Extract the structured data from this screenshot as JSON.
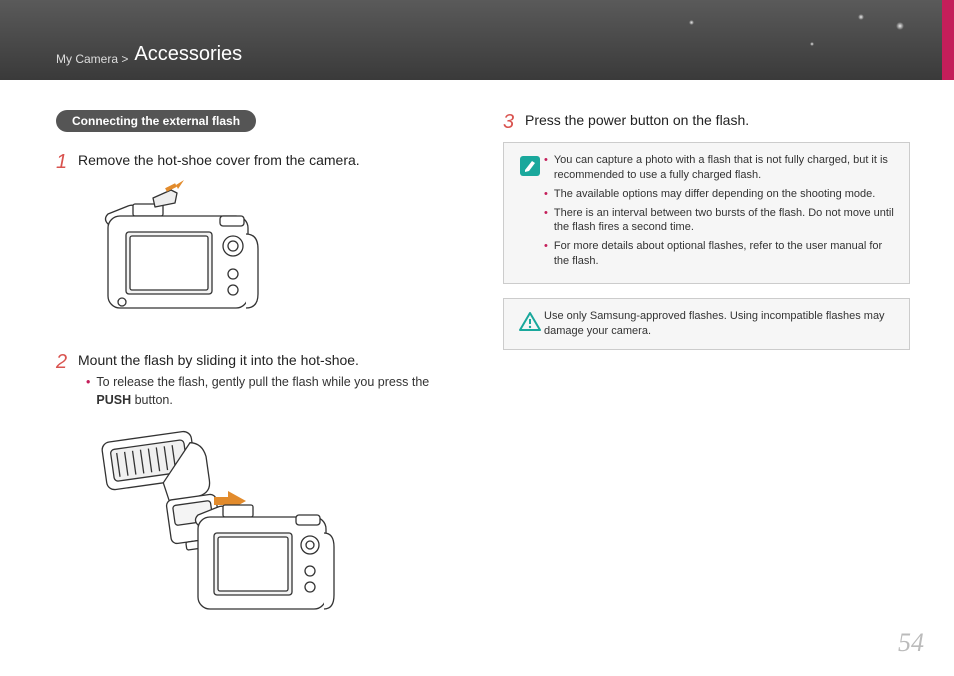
{
  "header": {
    "breadcrumb_parent": "My Camera >",
    "breadcrumb_title": "Accessories"
  },
  "left": {
    "section_label": "Connecting the external flash",
    "step1": {
      "num": "1",
      "text": "Remove the hot-shoe cover from the camera."
    },
    "step2": {
      "num": "2",
      "text": "Mount the flash by sliding it into the hot-shoe.",
      "sub_pre": "To release the flash, gently pull the flash while you press the ",
      "sub_bold": "PUSH",
      "sub_post": " button."
    }
  },
  "right": {
    "step3": {
      "num": "3",
      "text": "Press the power button on the flash."
    },
    "info": [
      "You can capture a photo with a flash that is not fully charged, but it is recommended to use a fully charged flash.",
      "The available options may differ depending on the shooting mode.",
      "There is an interval between two bursts of the flash. Do not move until the flash fires a second time.",
      "For more details about optional flashes, refer to the user manual for the flash."
    ],
    "warning": "Use only Samsung-approved flashes. Using incompatible flashes may damage your camera."
  },
  "page_number": "54"
}
